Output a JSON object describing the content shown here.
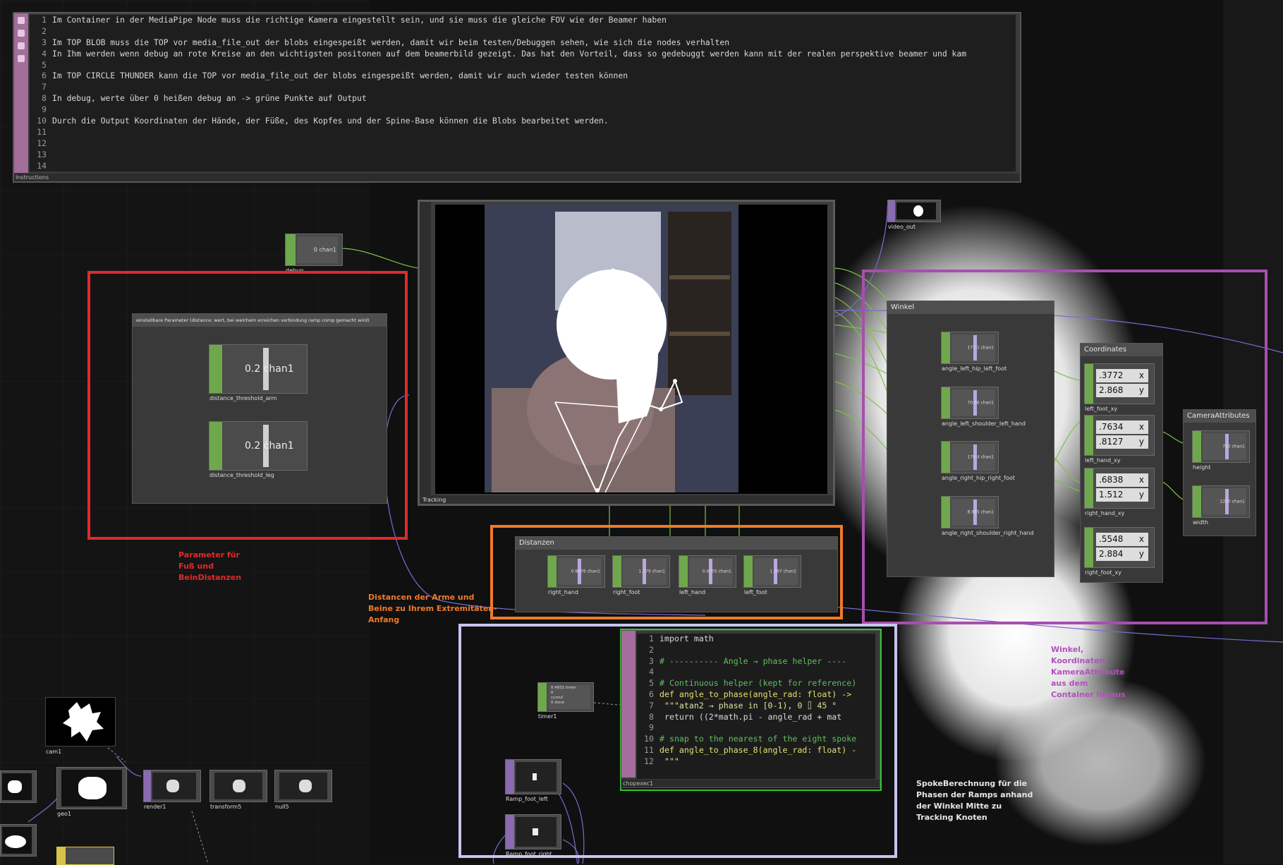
{
  "instructions": {
    "label": "Instructions",
    "lines": [
      {
        "n": "1",
        "text": "Im Container in der MediaPipe Node muss die richtige Kamera eingestellt sein, und sie muss die gleiche FOV wie der Beamer haben"
      },
      {
        "n": "2",
        "text": ""
      },
      {
        "n": "3",
        "text": "Im TOP BLOB muss die TOP vor media_file_out der blobs eingespeißt werden, damit wir beim testen/Debuggen sehen, wie sich die nodes verhalten"
      },
      {
        "n": "4",
        "text": "In Ihm werden wenn debug an rote Kreise an den wichtigsten positonen auf dem beamerbild gezeigt. Das hat den Vorteil, dass so gedebuggt werden kann mit der realen perspektive beamer und kam"
      },
      {
        "n": "5",
        "text": ""
      },
      {
        "n": "6",
        "text": "Im TOP CIRCLE THUNDER kann die TOP vor media_file_out der blobs eingespeißt werden, damit wir auch wieder testen können"
      },
      {
        "n": "7",
        "text": ""
      },
      {
        "n": "8",
        "text": "In debug, werte über 0 heißen debug an -> grüne Punkte auf Output"
      },
      {
        "n": "9",
        "text": ""
      },
      {
        "n": "10",
        "text": "Durch die Output Koordinaten der Hände, der Füße, des Kopfes und der Spine-Base können die Blobs bearbeitet werden."
      },
      {
        "n": "11",
        "text": ""
      },
      {
        "n": "12",
        "text": ""
      },
      {
        "n": "13",
        "text": ""
      },
      {
        "n": "14",
        "text": ""
      }
    ]
  },
  "nodes": {
    "debug": {
      "label": "debug",
      "value": "0 chan1"
    },
    "video_out": {
      "label": "video_out"
    },
    "tracking": {
      "label": "Tracking"
    },
    "params_container": {
      "title": "einstellbare Parameter (distance: wert, bei welchem erreichen verbindung ramp comp gemacht wird)"
    },
    "distance_threshold_arm": {
      "label": "distance_threshold_arm",
      "value": "0.2 chan1"
    },
    "distance_threshold_leg": {
      "label": "distance_threshold_leg",
      "value": "0.2 chan1"
    },
    "distanzen": {
      "title": "Distanzen",
      "items": [
        {
          "label": "right_hand",
          "value": "0.8076 chan1"
        },
        {
          "label": "right_foot",
          "value": "1.179 chan1"
        },
        {
          "label": "left_hand",
          "value": "0.4705 chan1"
        },
        {
          "label": "left_foot",
          "value": "1.397 chan1"
        }
      ]
    },
    "winkel": {
      "title": "Winkel",
      "items": [
        {
          "label": "angle_left_hip_left_foot",
          "value": "177.1 chan1"
        },
        {
          "label": "angle_left_shoulder_left_hand",
          "value": "70.66 chan1"
        },
        {
          "label": "angle_right_hip_right_foot",
          "value": "179.4 chan1"
        },
        {
          "label": "angle_right_shoulder_right_hand",
          "value": "8.985 chan1"
        }
      ]
    },
    "coordinates": {
      "title": "Coordinates",
      "items": [
        {
          "label": "left_foot_xy",
          "x": ".3772",
          "y": "2.868"
        },
        {
          "label": "left_hand_xy",
          "x": ".7634",
          "y": ".8127"
        },
        {
          "label": "right_hand_xy",
          "x": ".6838",
          "y": "1.512"
        },
        {
          "label": "right_foot_xy",
          "x": ".5548",
          "y": "2.884"
        }
      ],
      "x_key": "x",
      "y_key": "y"
    },
    "camera_attributes": {
      "title": "CameraAttributes",
      "items": [
        {
          "label": "height",
          "value": "720 chan1"
        },
        {
          "label": "width",
          "value": "1280 chan1"
        }
      ]
    },
    "timer1": {
      "label": "timer1",
      "lines": [
        "0.4931 timer",
        "0 ",
        "cumul",
        "0 done"
      ]
    },
    "ramp_foot_left": {
      "label": "Ramp_foot_left"
    },
    "ramp_foot_right": {
      "label": "Ramp_foot_right"
    },
    "chopexec1": {
      "label": "chopexec1"
    },
    "cam1": {
      "label": "cam1"
    },
    "geo1": {
      "label": "geo1"
    },
    "render1": {
      "label": "render1"
    },
    "transform5": {
      "label": "transform5"
    },
    "null5": {
      "label": "null5"
    }
  },
  "code": {
    "lines": [
      {
        "n": "1",
        "text": "import math",
        "cls": ""
      },
      {
        "n": "2",
        "text": "",
        "cls": ""
      },
      {
        "n": "3",
        "text": "# ---------- Angle → phase helper  ----",
        "cls": "cm"
      },
      {
        "n": "4",
        "text": "",
        "cls": ""
      },
      {
        "n": "5",
        "text": "# Continuous helper (kept for reference)",
        "cls": "cm"
      },
      {
        "n": "6",
        "text": "def angle_to_phase(angle_rad: float) ->",
        "cls": "fn"
      },
      {
        "n": "7",
        "text": "    \"\"\"atan2 → phase in [0-1), 0 ⌷ 45 °",
        "cls": "st"
      },
      {
        "n": "8",
        "text": "    return ((2*math.pi - angle_rad + mat",
        "cls": ""
      },
      {
        "n": "9",
        "text": "",
        "cls": ""
      },
      {
        "n": "10",
        "text": "# snap to the nearest of the eight spoke",
        "cls": "cm"
      },
      {
        "n": "11",
        "text": "def angle_to_phase_8(angle_rad: float) -",
        "cls": "fn"
      },
      {
        "n": "12",
        "text": "    \"\"\"",
        "cls": "st"
      }
    ]
  },
  "annotations": {
    "red": "Parameter für\nFuß und\nBeinDistanzen",
    "orange": "Distancen der Arme und\nBeine zu Ihrem Extremitäten-\nAnfang",
    "purple": "Winkel,\nKoordinaten,\nKameraAttribute\naus dem\nContainer hinaus",
    "white": "SpokeBerechnung für die\nPhasen der Ramps anhand\nder Winkel Mitte zu\nTracking Knoten"
  },
  "colors": {
    "red_frame": "#e02a2a",
    "orange_frame": "#f07a2a",
    "purple_frame": "#a64fae",
    "lavender_frame": "#c8c4ee",
    "green_frame": "#2ec82e",
    "chop_green": "#6fa84c",
    "dat_pink": "#a36d9c",
    "top_purple": "#8a6bb0"
  }
}
